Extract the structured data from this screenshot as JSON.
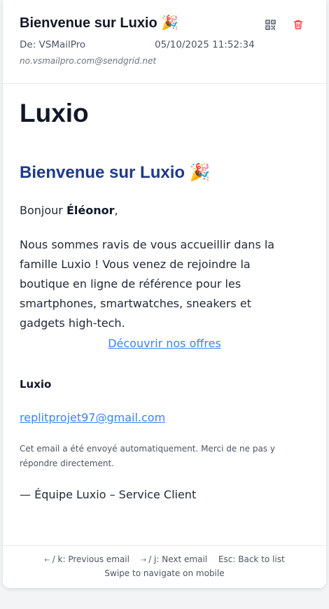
{
  "header": {
    "subject": "Bienvenue sur Luxio 🎉",
    "from": "De: VSMailPro",
    "date": "05/10/2025 11:52:34",
    "address": "no.vsmailpro.com@sendgrid.net",
    "qr_icon": "qr-code-icon",
    "trash_icon": "trash-icon",
    "trash_color": "#ef4444"
  },
  "email": {
    "brand": "Luxio",
    "welcome": "Bienvenue sur Luxio 🎉",
    "greeting_prefix": "Bonjour ",
    "greeting_name": "Éléonor",
    "greeting_suffix": ",",
    "intro": "Nous sommes ravis de vous accueillir dans la famille Luxio ! Vous venez de rejoindre la boutique en ligne de référence pour les smartphones, smartwatches, sneakers et gadgets high-tech.",
    "cta": "Découvrir nos offres",
    "signature_brand": "Luxio",
    "contact_email": "replitprojet97@gmail.com",
    "notice": "Cet email a été envoyé automatiquement. Merci de ne pas y répondre directement.",
    "team": "— Équipe Luxio – Service Client"
  },
  "footer": {
    "prev_arrow": "←",
    "prev": "/ k: Previous email",
    "next_arrow": "→",
    "next": "/ j: Next email",
    "esc": "Esc: Back to list",
    "swipe": "Swipe to navigate on mobile"
  },
  "colors": {
    "accent_blue": "#1e3a8a",
    "link_blue": "#3b82f6",
    "danger": "#ef4444"
  }
}
